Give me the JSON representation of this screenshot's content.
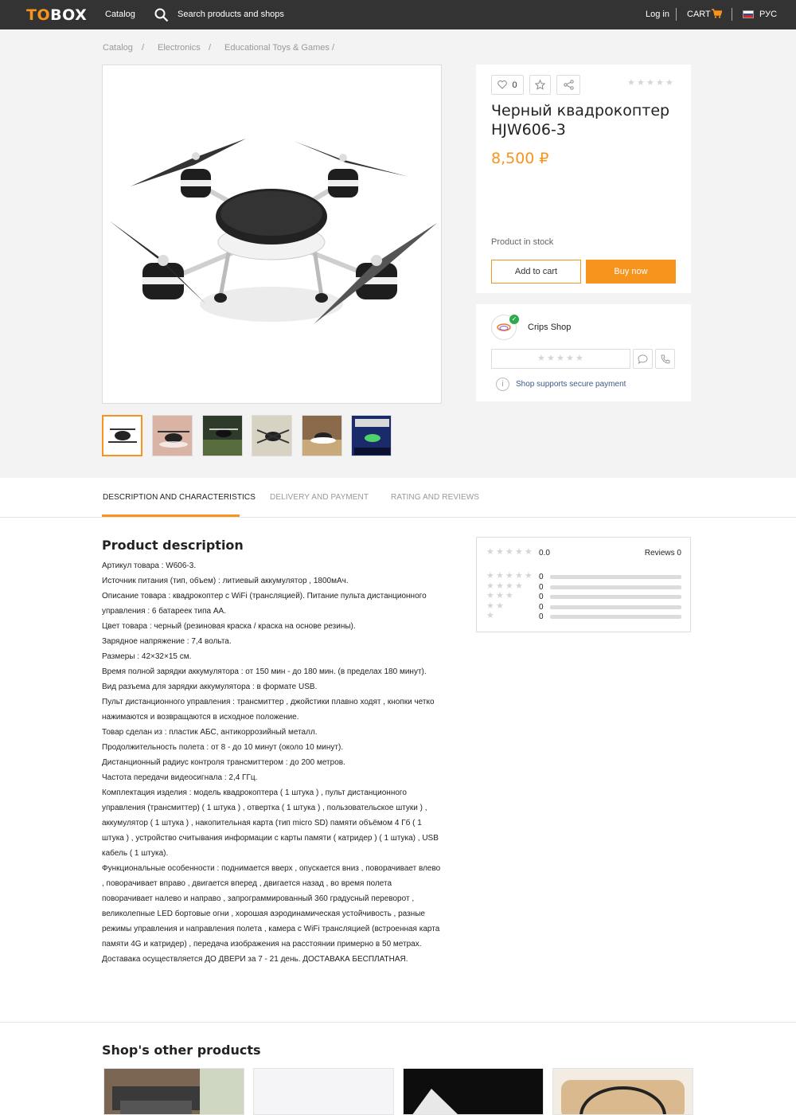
{
  "header": {
    "logo_left": "TO",
    "logo_right": "BOX",
    "catalog": "Catalog",
    "search_label": "Search products and shops",
    "login": "Log in",
    "cart": "CART",
    "language": "РУС"
  },
  "breadcrumbs": [
    "Catalog",
    "/",
    "Electronics",
    "/",
    "Educational Toys & Games",
    "/"
  ],
  "product": {
    "likes": "0",
    "title": "Черный квадрокоптер HJW606-3",
    "price": "8,500 ₽",
    "stock": "Product in stock",
    "add_to_cart": "Add to cart",
    "buy_now": "Buy now",
    "rating_stars": 0
  },
  "shop": {
    "name": "Crips Shop",
    "secure_payment": "Shop supports secure payment"
  },
  "tabs": [
    {
      "label": "DESCRIPTION AND CHARACTERISTICS",
      "active": true
    },
    {
      "label": "DELIVERY AND PAYMENT",
      "active": false
    },
    {
      "label": "RATING AND REVIEWS",
      "active": false
    }
  ],
  "description": {
    "title": "Product description",
    "lines": [
      "Артикул товара : W606-3.",
      "Источник питания (тип, объем) : литиевый аккумулятор , 1800мАч.",
      "Описание товара : квадрокоптер с WiFi (трансляцией). Питание пульта дистанционного управления : 6 батареек типа АА.",
      "Цвет товара : черный (резиновая краска / краска на основе резины).",
      "Зарядное напряжение : 7,4 вольта.",
      "Размеры : 42×32×15 см.",
      "Время полной зарядки аккумулятора : от 150 мин - до 180 мин. (в пределах 180 минут).",
      "Вид разъема для зарядки аккумулятора : в формате USB.",
      "Пульт дистанционного управления : трансмиттер , джойстики плавно ходят , кнопки четко нажимаются и возвращаются в исходное положение.",
      "Товар сделан из : пластик АБС,   антикоррозийный металл.",
      "Продолжительность полета : от 8 - до 10 минут (около 10 минут).",
      "Дистанционный радиус контроля трансмиттером : до 200 метров.",
      "Частота передачи видеосигнала : 2,4 ГГц.",
      "Комплектация изделия : модель квадрокоптера ( 1 штука ) , пульт дистанционного управления (трансмиттер) ( 1 штука ) , отвертка ( 1 штука ) ,   пользовательское штуки ) , аккумулятор ( 1 штука ) , накопительная карта (тип micro SD) памяти объёмом 4 Гб ( 1 штука ) , устройство считывания информации с карты памяти ( катридер ) ( 1 штука) , USB кабель ( 1 штука).",
      "Функциональные особенности : поднимается вверх , опускается вниз , поворачивает влево , поворачивает вправо , двигается вперед , двигается назад , во время полета поворачивает налево и направо , запрограммированный 360 градусный переворот , великолепные LED бортовые огни , хорошая аэродинамическая устойчивость , разные режимы управления и направления полета , камера с WiFi трансляцией  (встроенная карта памяти 4G и катридер) , передача изображения на расстоянии примерно в 50 метрах.",
      "Доставака осуществляется ДО ДВЕРИ за 7 - 21 день. ДОСТАВАКА БЕСПЛАТНАЯ."
    ]
  },
  "reviews": {
    "score": "0.0",
    "count_label": "Reviews 0",
    "rows": [
      {
        "stars": 5,
        "count": "0"
      },
      {
        "stars": 4,
        "count": "0"
      },
      {
        "stars": 3,
        "count": "0"
      },
      {
        "stars": 2,
        "count": "0"
      },
      {
        "stars": 1,
        "count": "0"
      }
    ]
  },
  "other_products": {
    "title": "Shop's other products"
  },
  "colors": {
    "accent": "#f7941d",
    "topbar": "#333333",
    "verified": "#2eaa4a"
  }
}
